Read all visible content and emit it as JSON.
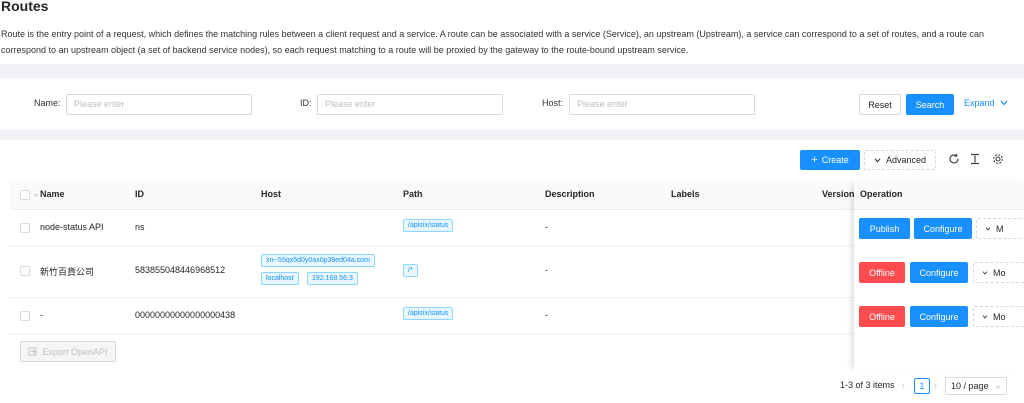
{
  "page": {
    "title": "Routes",
    "description": "Route is the entry point of a request, which defines the matching rules between a client request and a service. A route can be associated with a service (Service), an upstream (Upstream), a service can correspond to a set of routes, and a route can correspond to an upstream object (a set of backend service nodes), so each request matching to a route will be proxied by the gateway to the route-bound upstream service."
  },
  "search": {
    "name_label": "Name",
    "name_placeholder": "Please enter",
    "id_label": "ID",
    "id_placeholder": "Please enter",
    "host_label": "Host",
    "host_placeholder": "Please enter",
    "reset": "Reset",
    "search": "Search",
    "expand": "Expand"
  },
  "toolbar": {
    "create": "Create",
    "advanced": "Advanced",
    "icons": [
      "reload-icon",
      "column-height-icon",
      "setting-icon"
    ]
  },
  "table": {
    "columns": [
      "Name",
      "ID",
      "Host",
      "Path",
      "Description",
      "Labels",
      "Version",
      "Operation"
    ],
    "rows": [
      {
        "name": "node-status API",
        "id": "ns",
        "hosts": [],
        "path": "/apisix/status",
        "description": "-",
        "actions": {
          "primary": "Publish",
          "configure": "Configure",
          "more": "M"
        }
      },
      {
        "name": "新竹百貨公司",
        "id": "583855048446968512",
        "hosts": [
          "xn--55qx5d0y0ax0p39ed04a.com",
          "localhost",
          "192.168.56.3"
        ],
        "path": "/*",
        "description": "-",
        "actions": {
          "primary": "Offline",
          "configure": "Configure",
          "more": "Mo"
        }
      },
      {
        "name": "-",
        "id": "00000000000000000438",
        "hosts": [],
        "path": "/apisix/status",
        "description": "-",
        "actions": {
          "primary": "Offline",
          "configure": "Configure",
          "more": "Mo"
        }
      }
    ],
    "export": "Export OpenAPI"
  },
  "pagination": {
    "summary": "1-3 of 3 items",
    "current_page": "1",
    "page_size": "10 / page"
  },
  "colors": {
    "primary": "#1890ff",
    "danger": "#ff4d4f"
  }
}
